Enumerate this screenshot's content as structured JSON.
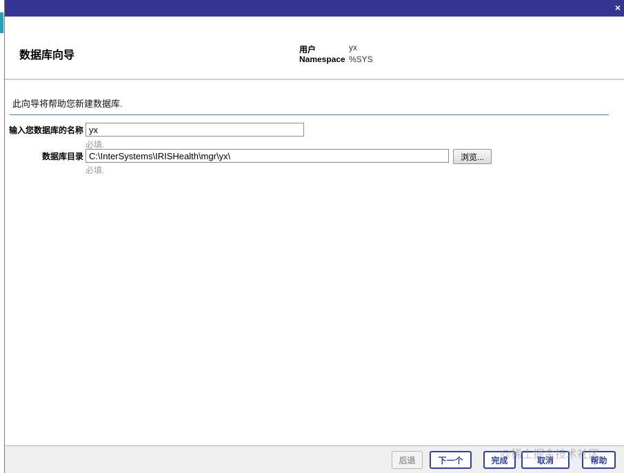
{
  "header": {
    "title": "数据库向导",
    "user_label": "用户",
    "user_value": "yx",
    "namespace_label": "Namespace",
    "namespace_value": "%SYS"
  },
  "intro": "此向导将帮助您新建数据库.",
  "form": {
    "name_label": "输入您数据库的名称",
    "name_value": "yx",
    "name_hint": "必填.",
    "dir_label": "数据库目录",
    "dir_value": "C:\\InterSystems\\IRISHealth\\mgr\\yx\\",
    "dir_hint": "必填.",
    "browse_label": "浏览..."
  },
  "footer": {
    "back_label": "后退",
    "next_label": "下一个",
    "finish_label": "完成",
    "cancel_label": "取消",
    "help_label": "帮助"
  },
  "titlebar": {
    "close_glyph": "×"
  },
  "watermark": "@稀土掘金技术社区",
  "colors": {
    "titlebar": "#353594",
    "accent_rule": "#2a8fa6",
    "button_border": "#2f3fa0"
  },
  "icons": {
    "close": "close-icon"
  }
}
